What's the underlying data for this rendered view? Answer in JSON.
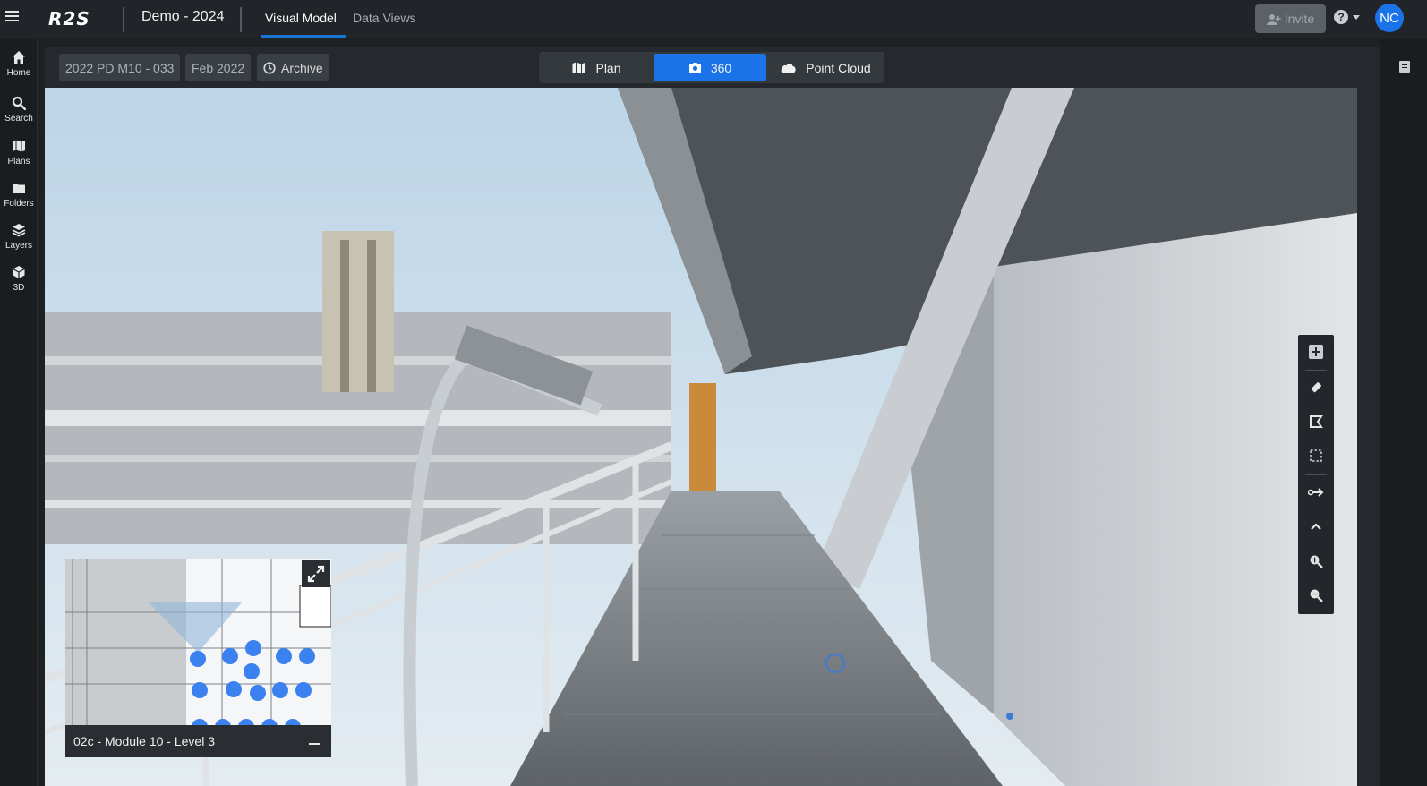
{
  "app": {
    "logo": "R2S",
    "project_title": "Demo - 2024",
    "tabs": [
      {
        "label": "Visual Model",
        "active": true
      },
      {
        "label": "Data Views",
        "active": false
      }
    ],
    "invite_label": "Invite",
    "help_icon": "question-circle-icon",
    "avatar_initials": "NC",
    "accent_color": "#1a73e8"
  },
  "sidebar": {
    "items": [
      {
        "label": "Home",
        "icon": "home-icon"
      },
      {
        "label": "Search",
        "icon": "search-icon"
      },
      {
        "label": "Plans",
        "icon": "map-icon"
      },
      {
        "label": "Folders",
        "icon": "folder-icon"
      },
      {
        "label": "Layers",
        "icon": "layers-icon"
      },
      {
        "label": "3D",
        "icon": "cube-icon"
      }
    ]
  },
  "toolbar": {
    "location": "2022 PD M10 - 033",
    "date": "Feb 2022",
    "archive_label": "Archive",
    "view_modes": [
      {
        "label": "Plan",
        "icon": "map-icon",
        "active": false
      },
      {
        "label": "360",
        "icon": "camera-icon",
        "active": true
      },
      {
        "label": "Point Cloud",
        "icon": "cloud-icon",
        "active": false
      }
    ]
  },
  "viewer_tools": [
    {
      "icon": "add-icon"
    },
    {
      "icon": "ruler-icon"
    },
    {
      "icon": "tag-icon"
    },
    {
      "icon": "select-area-icon"
    },
    {
      "icon": "link-arrow-icon"
    },
    {
      "icon": "chevron-up-icon"
    },
    {
      "icon": "zoom-in-icon"
    },
    {
      "icon": "zoom-out-icon"
    }
  ],
  "minimap": {
    "title": "02c - Module 10 - Level 3",
    "expand_icon": "expand-icon",
    "minimize_icon": "minimize-icon"
  }
}
